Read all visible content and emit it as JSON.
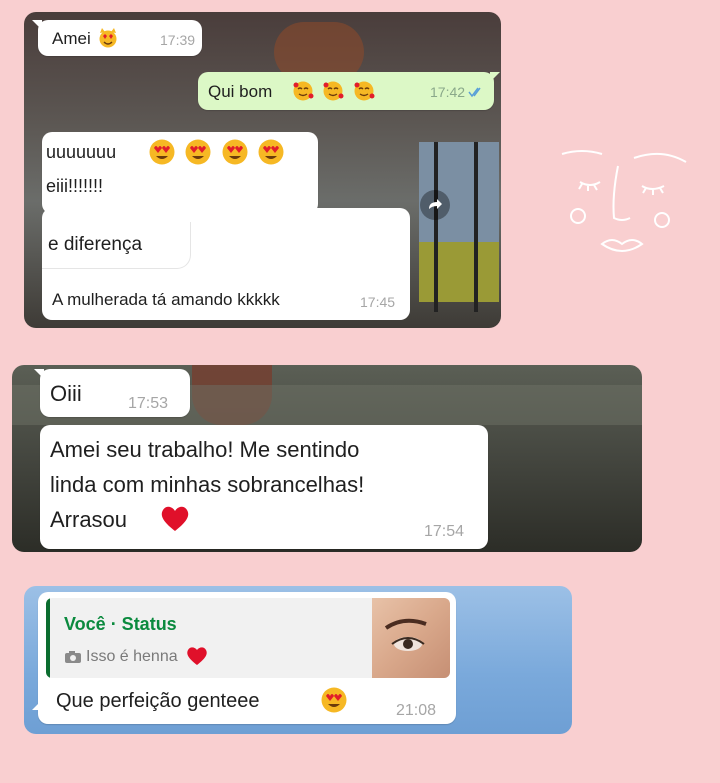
{
  "colors": {
    "background": "#f9cfd0",
    "incoming": "#ffffff",
    "outgoing": "#dcf8c6",
    "reply_accent": "#0b8a3e",
    "heart": "#e0102a"
  },
  "chat1": {
    "msg1": {
      "text": "Amei",
      "emoji": "smiling-cat-heart-eyes",
      "time": "17:39"
    },
    "msg2": {
      "text": "Qui bom",
      "emoji": "smiling-face-hearts",
      "time": "17:42"
    },
    "msg3": {
      "line1": "uuuuuuu",
      "line2": "eiii!!!!!!!",
      "emoji": "heart-eyes"
    },
    "msg4": {
      "text": "e diferença"
    },
    "msg5": {
      "text": "A mulherada tá amando kkkkk",
      "time": "17:45"
    }
  },
  "chat2": {
    "msg1": {
      "text": "Oiii",
      "time": "17:53"
    },
    "msg2": {
      "line1": "Amei seu trabalho! Me sentindo",
      "line2": "linda com minhas sobrancelhas!",
      "line3": "Arrasou",
      "time": "17:54"
    }
  },
  "chat3": {
    "reply": {
      "author": "Você · Status",
      "caption": "Isso é henna"
    },
    "msg": {
      "text": "Que perfeição genteee",
      "time": "21:08"
    }
  }
}
